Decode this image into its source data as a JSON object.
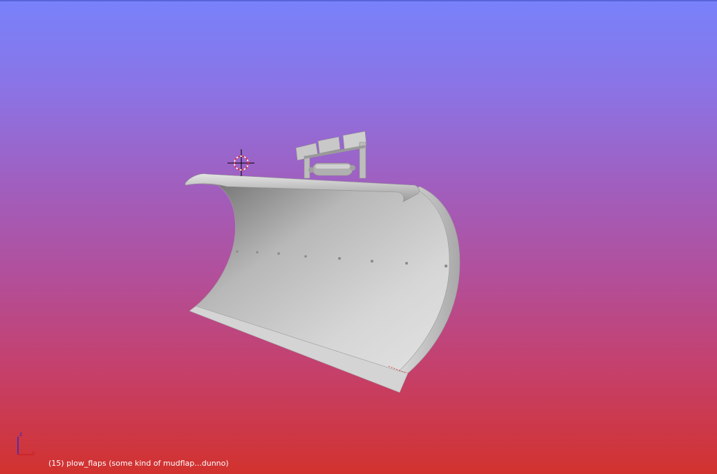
{
  "viewport": {
    "background_top": "#7882fb",
    "background_bottom": "#d2322e",
    "object_info": "(15) plow_flaps (some kind of mudflap...dunno)"
  },
  "axes": {
    "z_label": "z",
    "x_label": "x",
    "z_color": "#2a2acc",
    "x_color": "#cc2222"
  },
  "cursor": {
    "icon": "3d-cursor-icon"
  }
}
